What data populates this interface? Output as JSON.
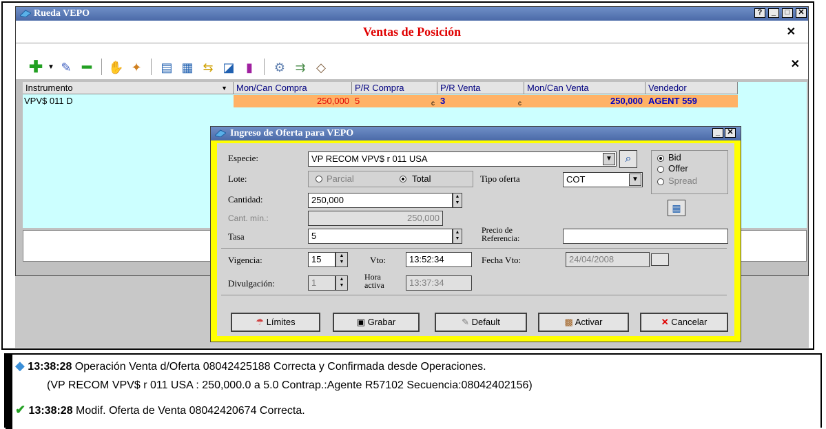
{
  "main_window": {
    "title": "Rueda VEPO",
    "heading": "Ventas de Posición",
    "close_glyph": "✕"
  },
  "toolbar": {
    "icons": [
      "add-icon",
      "dropdown-arrow-icon",
      "pencil-icon",
      "remove-icon",
      "handshake-icon",
      "magic-wand-icon",
      "table-icon",
      "grid-icon",
      "arrows-icon",
      "line-chart-icon",
      "bar-chart-icon",
      "gear-icon",
      "transfer-icon",
      "eraser-icon"
    ]
  },
  "grid": {
    "columns": [
      "Instrumento",
      "Mon/Can Compra",
      "P/R Compra",
      "P/R Venta",
      "Mon/Can Venta",
      "Vendedor"
    ],
    "row": {
      "instrumento": "VPV$ 011 D",
      "mon_can_compra": "250,000",
      "pr_compra": "5",
      "pr_compra_suffix": "c",
      "pr_venta": "3",
      "pr_venta_suffix": "c",
      "mon_can_venta": "250,000",
      "vendedor": "AGENT 559"
    },
    "colors": {
      "orange": "#ffb266",
      "row_bg": "#ccffff"
    }
  },
  "dialog": {
    "title": "Ingreso de Oferta para VEPO",
    "especie_label": "Especie:",
    "especie_value": "VP RECOM VPV$  r 011 USA",
    "lote_label": "Lote:",
    "lote_parcial": "Parcial",
    "lote_total": "Total",
    "tipo_oferta_label": "Tipo oferta",
    "tipo_oferta_value": "COT",
    "side_bid": "Bid",
    "side_offer": "Offer",
    "side_spread": "Spread",
    "cantidad_label": "Cantidad:",
    "cantidad_value": "250,000",
    "cant_min_label": "Cant. mín.:",
    "cant_min_value": "250,000",
    "tasa_label": "Tasa",
    "tasa_value": "5",
    "precio_ref_label_1": "Precio de",
    "precio_ref_label_2": "Referencia:",
    "precio_ref_value": "",
    "vigencia_label": "Vigencia:",
    "vigencia_value": "15",
    "vto_label": "Vto:",
    "vto_value": "13:52:34",
    "fecha_vto_label": "Fecha Vto:",
    "fecha_vto_value": "24/04/2008",
    "divulgacion_label": "Divulgación:",
    "divulgacion_value": "1",
    "hora_activa_label_1": "Hora",
    "hora_activa_label_2": "activa",
    "hora_activa_value": "13:37:34",
    "buttons": {
      "limites": "Límites",
      "grabar": "Grabar",
      "default": "Default",
      "activar": "Activar",
      "cancelar": "Cancelar"
    }
  },
  "messages": [
    {
      "icon": "diamond-icon",
      "time": "13:38:28",
      "text": "Operación Venta d/Oferta 08042425188 Correcta y Confirmada desde Operaciones.",
      "detail": "(VP RECOM VPV$  r 011 USA : 250,000.0 a 5.0 Contrap.:Agente R57102 Secuencia:08042402156)"
    },
    {
      "icon": "checkmark-icon",
      "time": "13:38:28",
      "text": "Modif. Oferta de Venta 08042420674 Correcta."
    }
  ]
}
